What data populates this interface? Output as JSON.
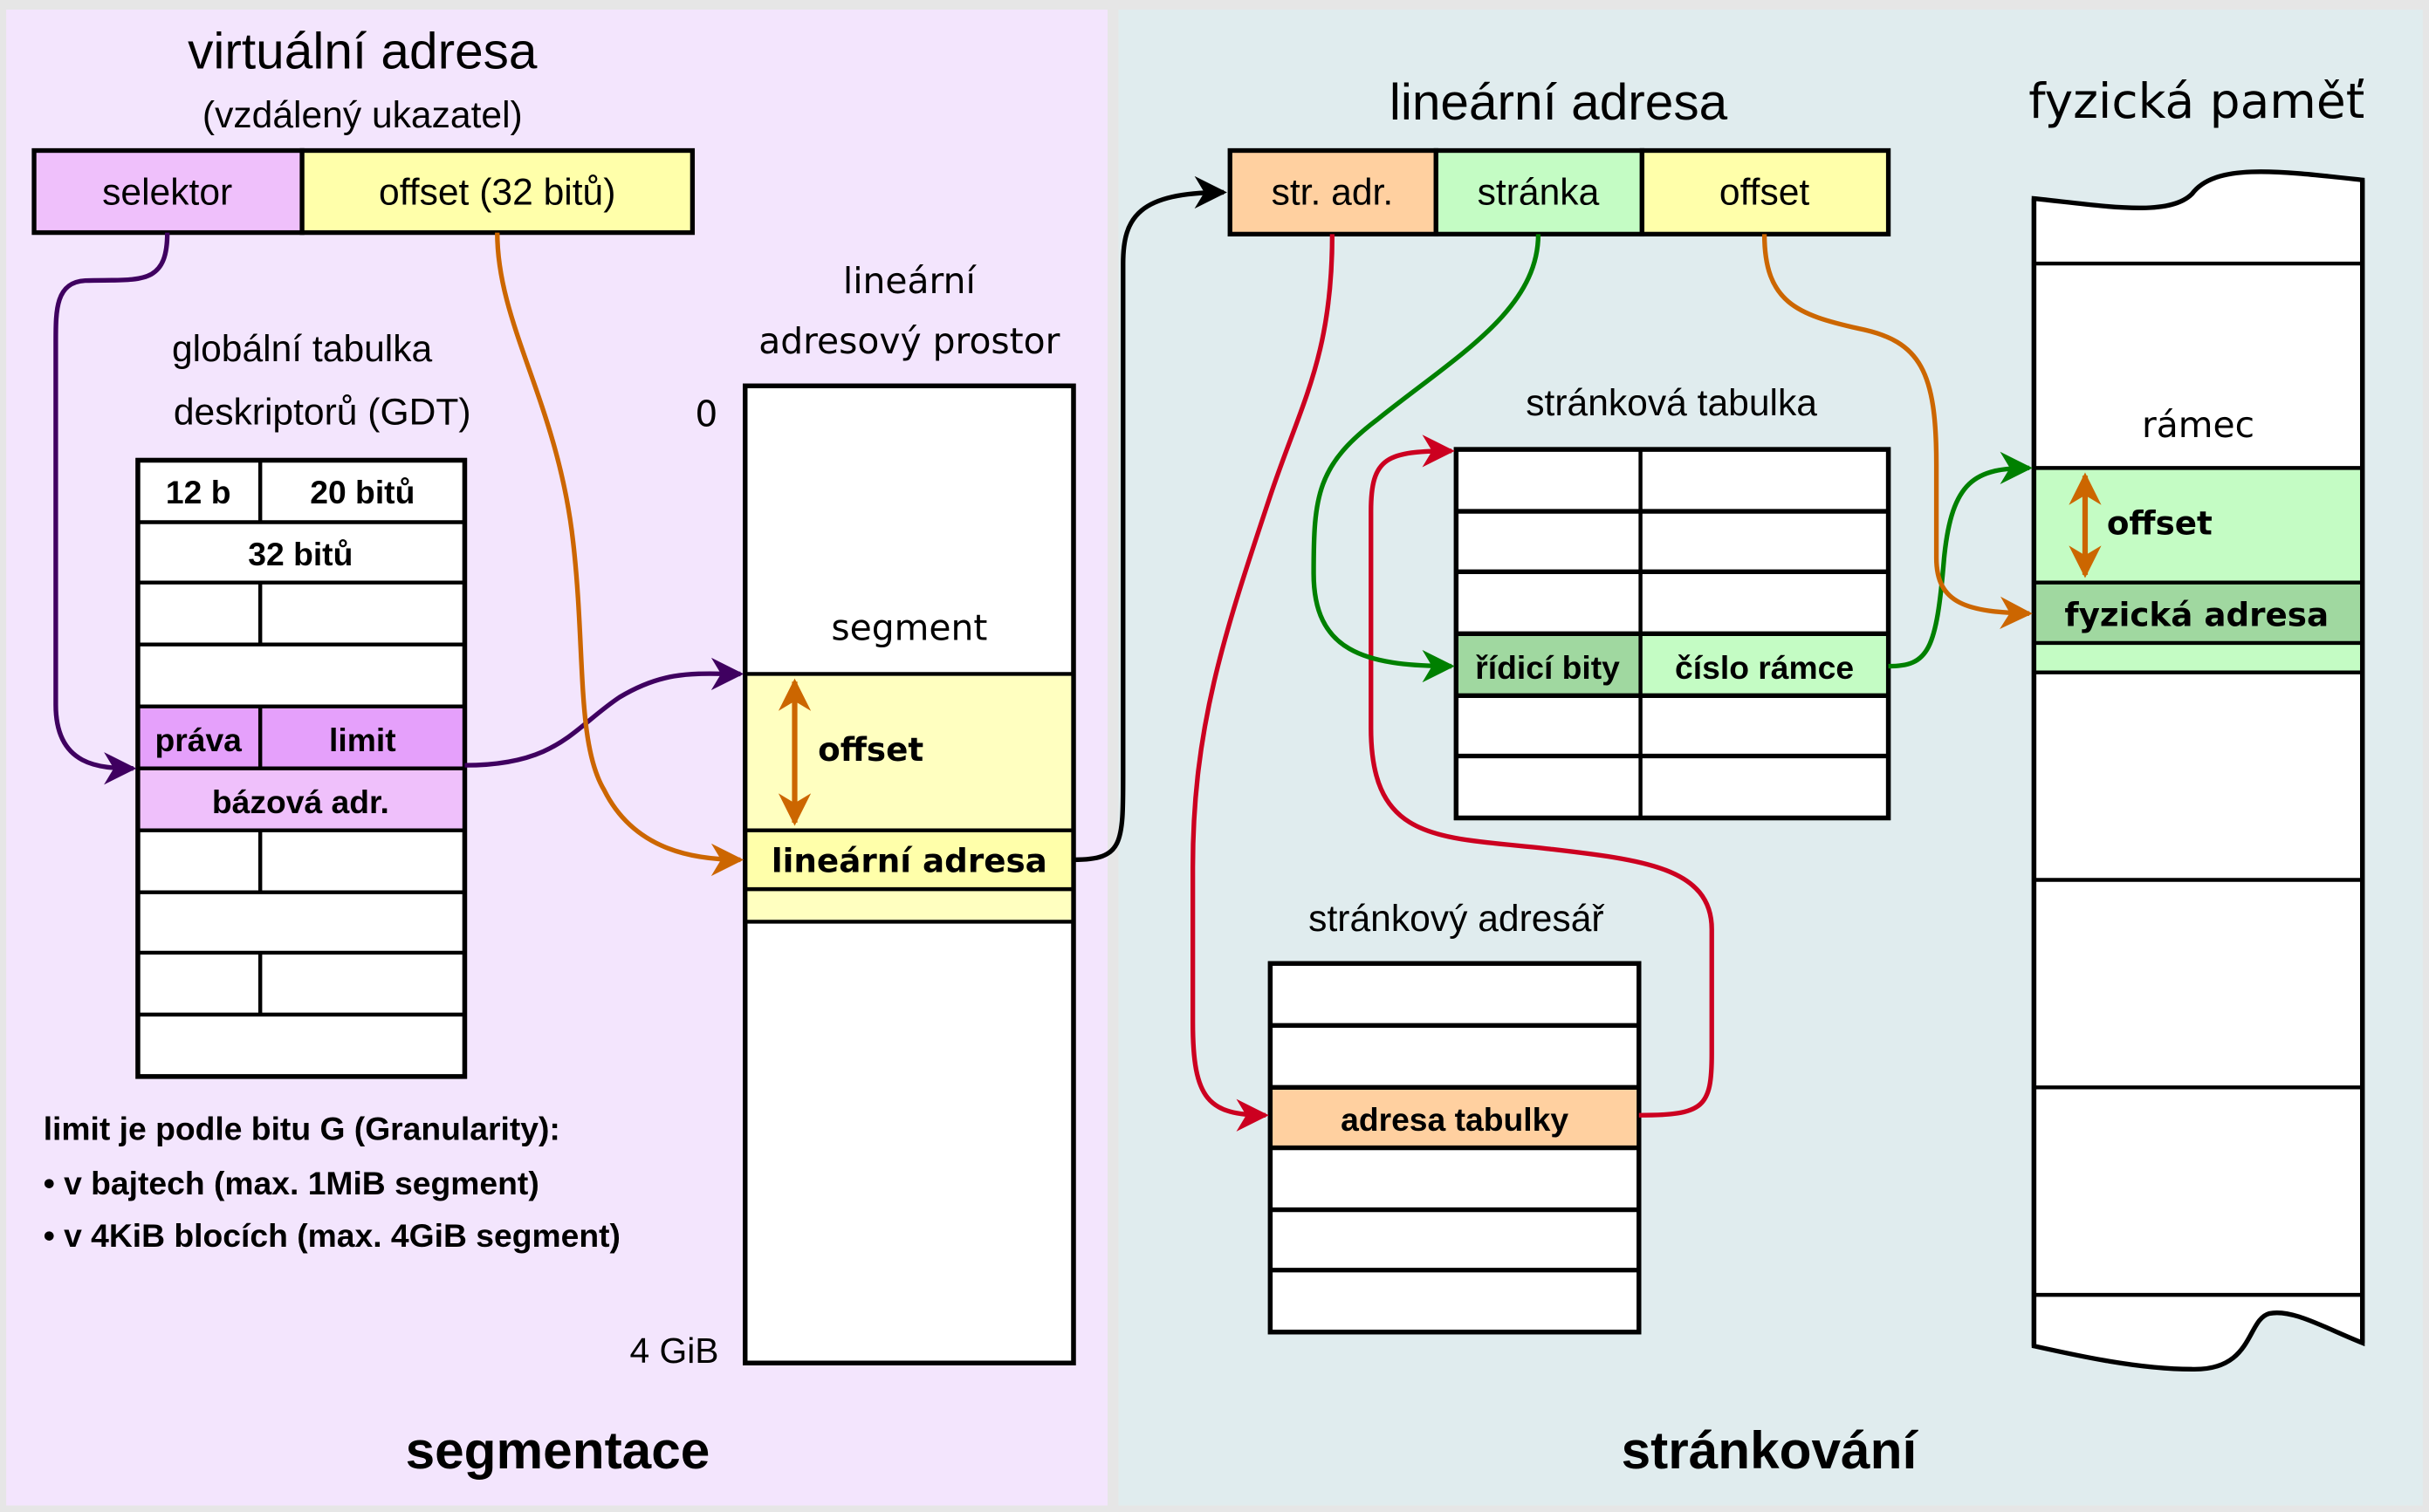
{
  "colors": {
    "outer": "#e6e6e6",
    "segmentation_bg": "#f3e5fd",
    "paging_bg": "#e0ecee",
    "selector": "#efc0fb",
    "descriptor_limit": "#e5a0fb",
    "descriptor_base": "#efc0fb",
    "yellow": "#ffffaa",
    "yellow_pale": "#ffffc0",
    "orange": "#ffd0a0",
    "green_pale": "#c4fcc4",
    "green_dark": "#a0d8a0",
    "wire_purple": "#3f0060",
    "wire_orange": "#cc6600",
    "wire_red": "#cc0020",
    "wire_green": "#008000",
    "wire_black": "#000000"
  },
  "segmentation": {
    "section_label": "segmentace",
    "virtual_address": {
      "title": "virtuální adresa",
      "subtitle": "(vzdálený ukazatel)",
      "fields": [
        "selektor",
        "offset (32 bitů)"
      ]
    },
    "gdt": {
      "title_line1": "globální tabulka",
      "title_line2": "deskriptorů (GDT)",
      "header_row1": [
        "12 b",
        "20 bitů"
      ],
      "header_row2": "32 bitů",
      "descriptor_row1": [
        "práva",
        "limit"
      ],
      "descriptor_row2": "bázová adr."
    },
    "note": {
      "title": "limit je podle bitu G (Granularity):",
      "items": [
        "• v bajtech (max. 1MiB segment)",
        "• v 4KiB blocích (max. 4GiB segment)"
      ]
    },
    "linear_space": {
      "title_line1": "lineární",
      "title_line2": "adresový prostor",
      "top_label": "0",
      "bottom_label": "4 GiB",
      "segment_label": "segment",
      "offset_label": "offset",
      "linear_address_label": "lineární adresa"
    }
  },
  "paging": {
    "section_label": "stránkování",
    "linear_address": {
      "title": "lineární adresa",
      "fields": [
        "str. adr.",
        "stránka",
        "offset"
      ]
    },
    "page_table": {
      "title": "stránková tabulka",
      "entry": [
        "řídicí bity",
        "číslo rámce"
      ]
    },
    "page_directory": {
      "title": "stránkový adresář",
      "entry": "adresa tabulky"
    },
    "physical_memory": {
      "title": "fyzická paměť",
      "frame_label": "rámec",
      "offset_label": "offset",
      "physical_address_label": "fyzická adresa"
    }
  }
}
